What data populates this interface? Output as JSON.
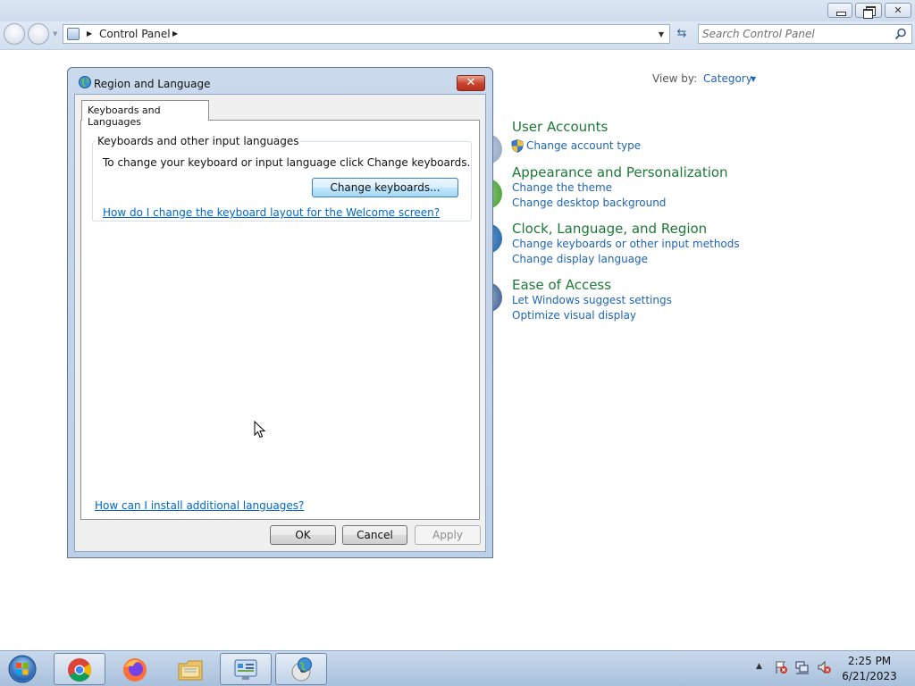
{
  "address_bar": {
    "crumb": "Control Panel",
    "search_placeholder": "Search Control Panel"
  },
  "view_by": {
    "label": "View by:",
    "value": "Category"
  },
  "categories": [
    {
      "title": "User Accounts",
      "links": [
        "Change account type"
      ]
    },
    {
      "title": "Appearance and Personalization",
      "links": [
        "Change the theme",
        "Change desktop background"
      ]
    },
    {
      "title": "Clock, Language, and Region",
      "links": [
        "Change keyboards or other input methods",
        "Change display language"
      ]
    },
    {
      "title": "Ease of Access",
      "links": [
        "Let Windows suggest settings",
        "Optimize visual display"
      ]
    }
  ],
  "dialog": {
    "title": "Region and Language",
    "tab_label": "Keyboards and Languages",
    "group_label": "Keyboards and other input languages",
    "group_description": "To change your keyboard or input language click Change keyboards.",
    "change_keyboards_button": "Change keyboards...",
    "welcome_link": "How do I change the keyboard layout for the Welcome screen?",
    "install_link": "How can I install additional languages?",
    "ok_button": "OK",
    "cancel_button": "Cancel",
    "apply_button": "Apply"
  },
  "taskbar": {
    "items": [
      "start-orb",
      "chrome-icon",
      "firefox-icon",
      "file-explorer-icon",
      "control-panel-icon",
      "region-language-icon"
    ],
    "time": "2:25 PM",
    "date": "6/21/2023"
  },
  "colors": {
    "category_title": "#1b7a36",
    "link": "#1e64b4",
    "dialog_link": "#0066cc"
  }
}
